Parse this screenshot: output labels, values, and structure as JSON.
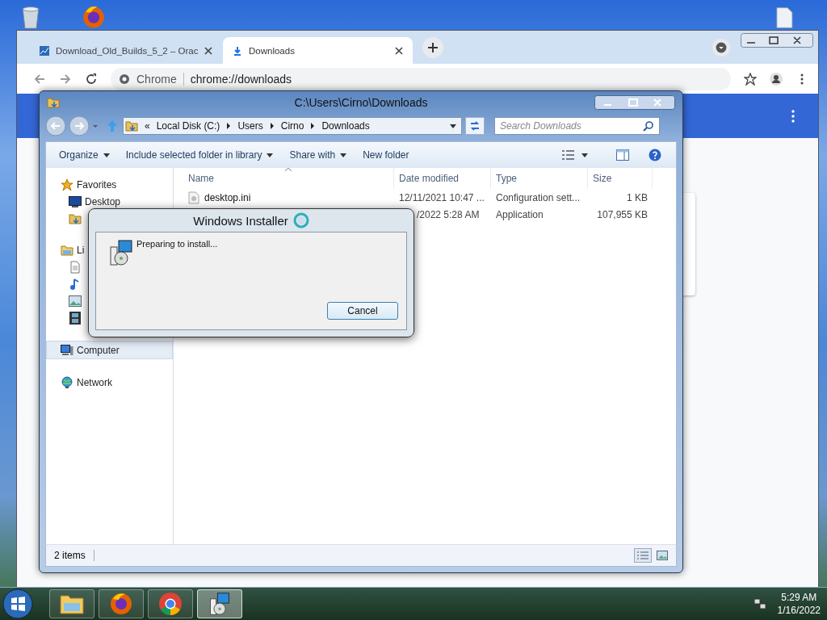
{
  "chrome": {
    "tabs": [
      {
        "title": "Download_Old_Builds_5_2 – Orac",
        "kind": "page",
        "selected": false
      },
      {
        "title": "Downloads",
        "kind": "download",
        "selected": true
      }
    ],
    "omnibox": {
      "site": "Chrome",
      "url": "chrome://downloads"
    }
  },
  "explorer": {
    "title": "C:\\Users\\Cirno\\Downloads",
    "breadcrumb": [
      "«",
      "Local Disk (C:)",
      "Users",
      "Cirno",
      "Downloads"
    ],
    "search": {
      "placeholder": "Search Downloads"
    },
    "toolbar": [
      {
        "label": "Organize",
        "dropdown": true
      },
      {
        "label": "Include selected folder in library",
        "dropdown": true
      },
      {
        "label": "Share with",
        "dropdown": true
      },
      {
        "label": "New folder",
        "dropdown": false
      }
    ],
    "nav": [
      {
        "kind": "favorites",
        "label": "Favorites",
        "selected": false,
        "children": [
          {
            "kind": "desktop",
            "label": "Desktop",
            "selected": false
          },
          {
            "kind": "downloads",
            "selected": false
          }
        ]
      },
      {
        "kind": "libraries",
        "label": "Li",
        "selected": false,
        "children": [
          {
            "kind": "documents",
            "selected": false
          },
          {
            "kind": "music",
            "selected": false
          },
          {
            "kind": "pictures",
            "selected": false
          },
          {
            "kind": "videos",
            "selected": false
          }
        ]
      },
      {
        "kind": "computer",
        "label": "Computer",
        "selected": true
      },
      {
        "kind": "network",
        "label": "Network",
        "selected": false
      }
    ],
    "columns": [
      "Name",
      "Date modified",
      "Type",
      "Size"
    ],
    "rows": [
      {
        "name": "desktop.ini",
        "date": "12/11/2021 10:47 ...",
        "type": "Configuration sett...",
        "size": "1 KB"
      },
      {
        "date": "/2022 5:28 AM",
        "type": "Application",
        "size": "107,955 KB"
      }
    ],
    "status": "2 items"
  },
  "dialog": {
    "title": "Windows Installer",
    "message": "Preparing to install...",
    "button": "Cancel"
  },
  "taskbar": {
    "apps": [
      {
        "kind": "explorer",
        "selected": false
      },
      {
        "kind": "firefox",
        "selected": false
      },
      {
        "kind": "chrome",
        "selected": false
      },
      {
        "kind": "installer",
        "selected": true
      }
    ],
    "time": "5:29 AM",
    "date": "1/16/2022"
  }
}
